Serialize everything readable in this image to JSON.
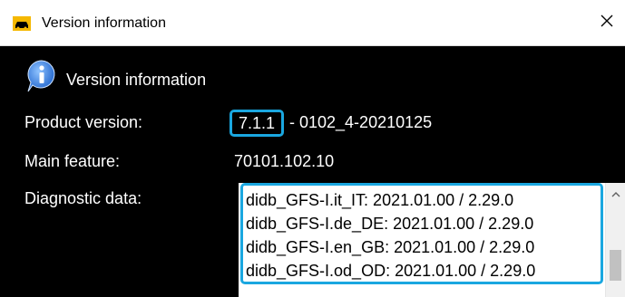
{
  "window": {
    "title": "Version information",
    "icon": "car-icon",
    "close_icon": "close-icon"
  },
  "header": {
    "icon": "info-icon",
    "text": "Version information"
  },
  "fields": {
    "product_version_label": "Product version:",
    "product_version_highlight": "7.1.1",
    "product_version_rest": "-  0102_4-20210125",
    "main_feature_label": "Main feature:",
    "main_feature_value": "70101.102.10",
    "diagnostic_label": "Diagnostic data:"
  },
  "diagnostic_data": [
    "didb_GFS-I.it_IT: 2021.01.00 / 2.29.0",
    "didb_GFS-I.de_DE: 2021.01.00 / 2.29.0",
    "didb_GFS-I.en_GB: 2021.01.00 / 2.29.0",
    "didb_GFS-I.od_OD: 2021.01.00 / 2.29.0"
  ],
  "colors": {
    "background": "#000000",
    "highlight": "#1aa7e0",
    "titlebar": "#ffffff"
  }
}
